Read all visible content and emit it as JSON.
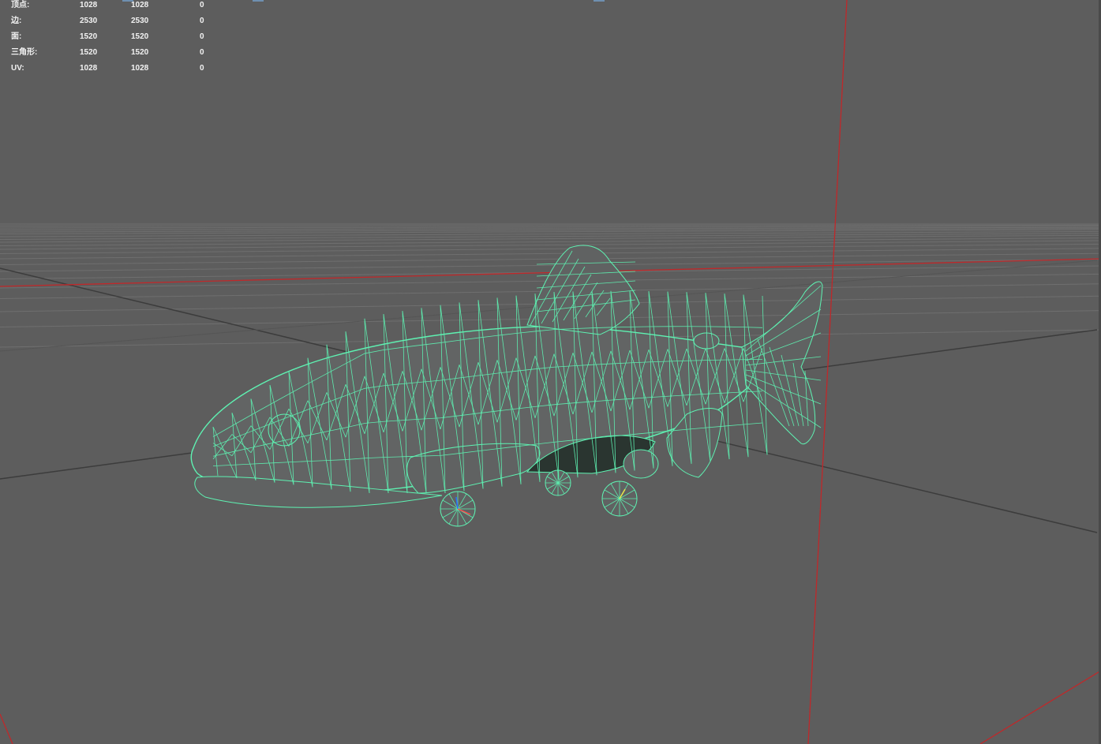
{
  "stats": {
    "rows": [
      {
        "label": "顶点:",
        "v1": "1028",
        "v2": "1028",
        "v3": "0"
      },
      {
        "label": "边:",
        "v1": "2530",
        "v2": "2530",
        "v3": "0"
      },
      {
        "label": "面:",
        "v1": "1520",
        "v2": "1520",
        "v3": "0"
      },
      {
        "label": "三角形:",
        "v1": "1520",
        "v2": "1520",
        "v3": "0"
      },
      {
        "label": "UV:",
        "v1": "1028",
        "v2": "1028",
        "v3": "0"
      }
    ]
  },
  "colors": {
    "background": "#5d5d5d",
    "grid": "#6f6f6f",
    "axis": "#3c3c3c",
    "red_axis": "#c0282a",
    "wireframe": "#5ef2b2"
  }
}
